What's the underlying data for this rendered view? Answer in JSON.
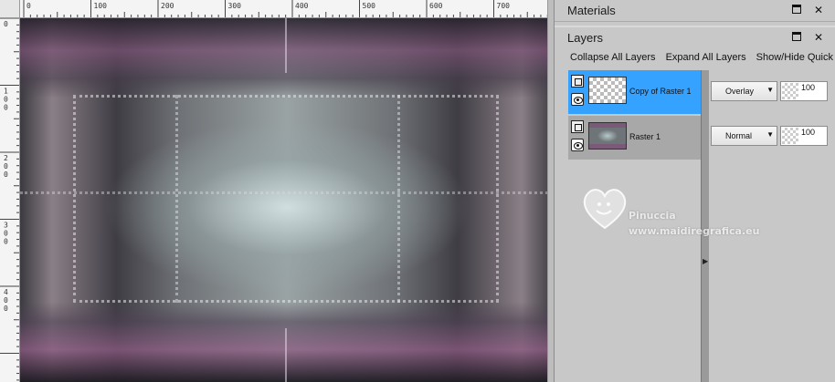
{
  "rulers": {
    "top_labels": [
      "0",
      "100",
      "200",
      "300",
      "400",
      "500",
      "600",
      "700"
    ],
    "left_labels": [
      "0",
      "1\n0\n0",
      "2\n0\n0",
      "3\n0\n0",
      "4\n0\n0"
    ]
  },
  "panels": {
    "materials": {
      "title": "Materials"
    },
    "layers": {
      "title": "Layers",
      "toolbar": {
        "collapse_label": "Collapse All Layers",
        "expand_label": "Expand All Layers",
        "showhide_label": "Show/Hide Quick"
      },
      "items": [
        {
          "name": "Copy of Raster 1",
          "blend_mode": "Overlay",
          "opacity": "100",
          "selected": true
        },
        {
          "name": "Raster 1",
          "blend_mode": "Normal",
          "opacity": "100",
          "selected": false
        }
      ]
    }
  },
  "watermark": {
    "name": "Pinuccia",
    "site": "www.maidiregrafica.eu"
  },
  "colors": {
    "selection": "#36a2ff",
    "panel_bg": "#c8c8c8"
  }
}
